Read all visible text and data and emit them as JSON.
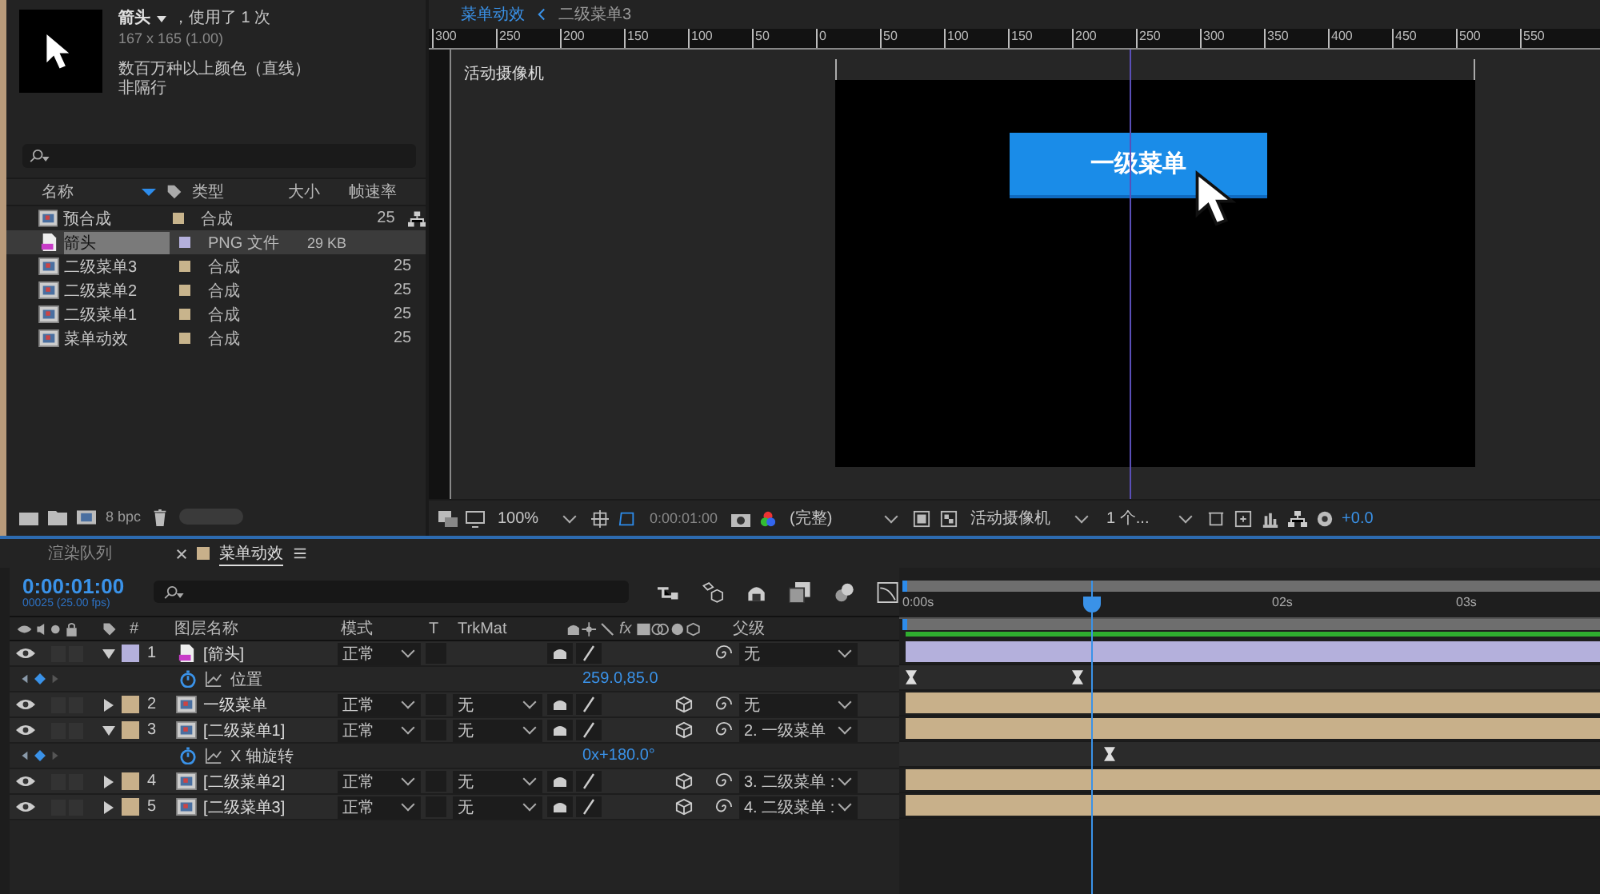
{
  "project": {
    "name": "箭头",
    "usage": "，使用了 1 次",
    "dims": "167 x 165 (1.00)",
    "color_info": "数百万种以上颜色（直线）",
    "field": "非隔行",
    "columns": [
      "名称",
      "类型",
      "大小",
      "帧速率"
    ],
    "items": [
      {
        "kind": "comp",
        "name": "预合成",
        "type": "合成",
        "fps": "25",
        "selected": false,
        "color": "#c8b48c"
      },
      {
        "kind": "footage",
        "name": "箭头",
        "type": "PNG 文件",
        "size": "29 KB",
        "selected": true,
        "color": "#b4b0dc"
      },
      {
        "kind": "comp",
        "name": "二级菜单3",
        "type": "合成",
        "fps": "25",
        "selected": false,
        "color": "#c8b48c"
      },
      {
        "kind": "comp",
        "name": "二级菜单2",
        "type": "合成",
        "fps": "25",
        "selected": false,
        "color": "#c8b48c"
      },
      {
        "kind": "comp",
        "name": "二级菜单1",
        "type": "合成",
        "fps": "25",
        "selected": false,
        "color": "#c8b48c"
      },
      {
        "kind": "comp",
        "name": "菜单动效",
        "type": "合成",
        "fps": "25",
        "selected": false,
        "color": "#c8b48c"
      }
    ],
    "bpc": "8 bpc"
  },
  "viewer": {
    "tabs": [
      {
        "label": "菜单动效",
        "selected": true
      },
      {
        "label": "二级菜单3",
        "selected": false
      }
    ],
    "ruler": [
      "300",
      "250",
      "200",
      "150",
      "100",
      "50",
      "0",
      "50",
      "100",
      "150",
      "200",
      "250",
      "300",
      "350",
      "400",
      "450",
      "500",
      "550"
    ],
    "camera_label": "活动摄像机",
    "menu_button": "一级菜单",
    "zoom": "100%",
    "time": "0:00:01:00",
    "quality": "(完整)",
    "view": "活动摄像机",
    "views": "1 个...",
    "exposure": "+0.0"
  },
  "timeline": {
    "tabs": [
      {
        "label": "渲染队列",
        "selected": false
      },
      {
        "label": "菜单动效",
        "selected": true
      }
    ],
    "time": "0:00:01:00",
    "frame": "00025 (25.00 fps)",
    "columns": {
      "number": "#",
      "name": "图层名称",
      "mode": "模式",
      "t": "T",
      "trkmat": "TrkMat",
      "fx": "fx",
      "parent": "父级"
    },
    "ruler": [
      "0:00s",
      "02s",
      "03s"
    ],
    "rows": [
      {
        "kind": "footage",
        "expanded": true,
        "color": "#b4b0dc",
        "number": "1",
        "name": "[箭头]",
        "mode": "正常",
        "parent": "无"
      },
      {
        "kind": "property",
        "name": "位置",
        "value": "259.0,85.0"
      },
      {
        "kind": "comp",
        "expanded": false,
        "color": "#c8b08a",
        "number": "2",
        "name": "一级菜单",
        "mode": "正常",
        "trkmat": "无",
        "parent": "无"
      },
      {
        "kind": "comp",
        "expanded": true,
        "color": "#c8b08a",
        "number": "3",
        "name": "[二级菜单1]",
        "mode": "正常",
        "trkmat": "无",
        "parent": "2. 一级菜单"
      },
      {
        "kind": "property",
        "name": "X 轴旋转",
        "value": "0x+180.0°"
      },
      {
        "kind": "comp",
        "expanded": false,
        "color": "#c8b08a",
        "number": "4",
        "name": "[二级菜单2]",
        "mode": "正常",
        "trkmat": "无",
        "parent": "3. 二级菜单 :"
      },
      {
        "kind": "comp",
        "expanded": false,
        "color": "#c8b08a",
        "number": "5",
        "name": "[二级菜单3]",
        "mode": "正常",
        "trkmat": "无",
        "parent": "4. 二级菜单 :"
      }
    ]
  }
}
